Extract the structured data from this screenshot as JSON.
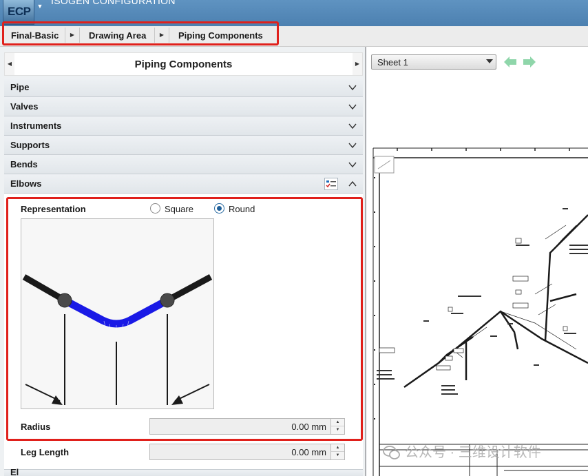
{
  "app": {
    "logo_text": "ECP",
    "title": "ISOGEN CONFIGURATION"
  },
  "breadcrumb": {
    "items": [
      "Final-Basic",
      "Drawing Area",
      "Piping Components"
    ]
  },
  "panel": {
    "title": "Piping Components",
    "sections": [
      "Pipe",
      "Valves",
      "Instruments",
      "Supports",
      "Bends",
      "Elbows"
    ],
    "next_section_partial": "El"
  },
  "elbows": {
    "representation_label": "Representation",
    "options": [
      {
        "label": "Square",
        "selected": false
      },
      {
        "label": "Round",
        "selected": true
      }
    ],
    "radius_label": "Radius",
    "radius_value": "0.00 mm",
    "leg_length_label": "Leg Length",
    "leg_length_value": "0.00 mm"
  },
  "viewer": {
    "sheet_selected": "Sheet 1"
  },
  "watermark": {
    "text": "公众号 · 三维设计软件"
  },
  "colors": {
    "titlebar": "#4c80b0",
    "highlight": "#e0201b",
    "elbow": "#1a1ae6",
    "pipe": "#1a1a1a",
    "nav_arrow": "#7fcf9e"
  }
}
